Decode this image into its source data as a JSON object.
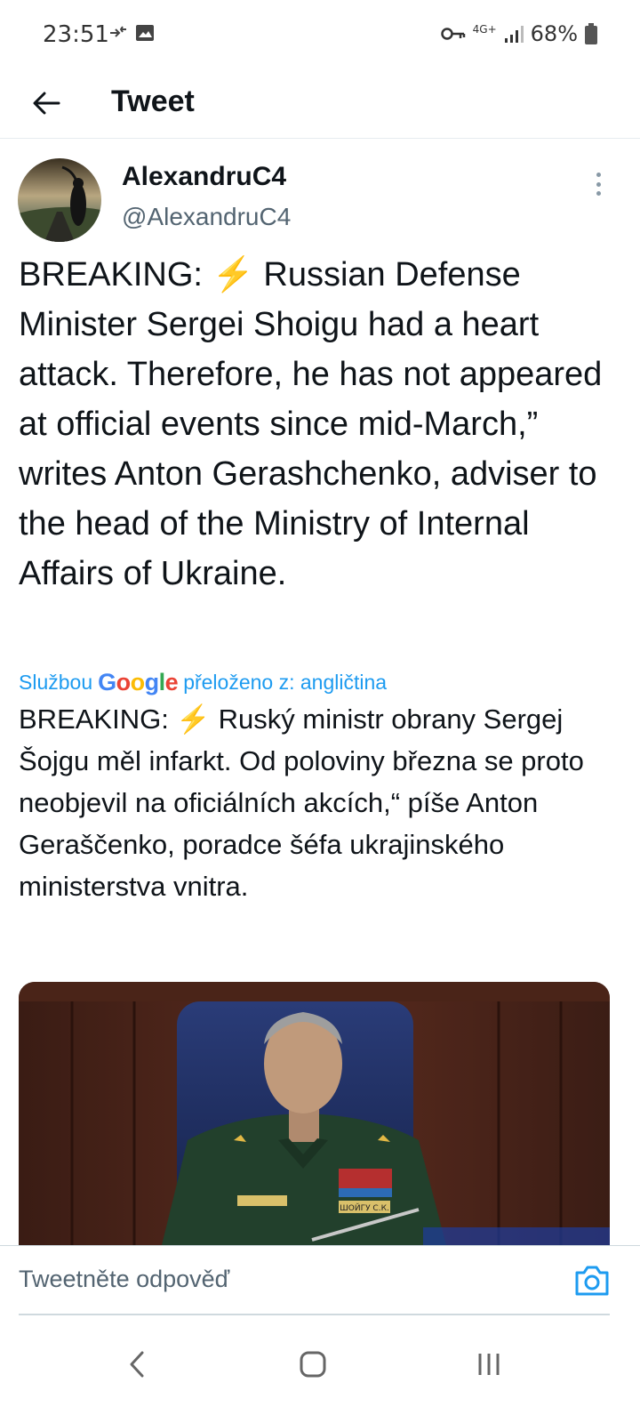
{
  "status_bar": {
    "time": "23:51",
    "battery": "68%",
    "network": "4G+"
  },
  "header": {
    "title": "Tweet"
  },
  "tweet": {
    "display_name": "AlexandruC4",
    "handle": "@AlexandruC4",
    "text": "BREAKING: ⚡ Russian Defense Minister Sergei Shoigu had a heart attack. Therefore, he has not appeared at official events since mid-March,” writes Anton Gerashchenko, adviser to the head of the Ministry of Internal Affairs of Ukraine.",
    "translation_prefix": "Službou",
    "translation_brand": "Google",
    "translation_suffix": "přeloženo z: angličtina",
    "translated_text": "BREAKING: ⚡ Ruský ministr obrany Sergej Šojgu měl infarkt. Od poloviny března se proto neobjevil na oficiálních akcích,“ píše Anton Geraščenko, poradce šéfa ukrajinského ministerstva vnitra.",
    "media_badge_text": "ШОЙГУ С.К."
  },
  "reply": {
    "placeholder": "Tweetněte odpověď"
  },
  "icons": {
    "back": "arrow-left-icon",
    "more": "more-vertical-icon",
    "camera": "camera-icon",
    "nav_back": "chevron-left-icon",
    "nav_home": "home-square-icon",
    "nav_recents": "recents-icon"
  },
  "colors": {
    "accent": "#1d9bf0",
    "text": "#0f1419",
    "secondary": "#536471"
  }
}
